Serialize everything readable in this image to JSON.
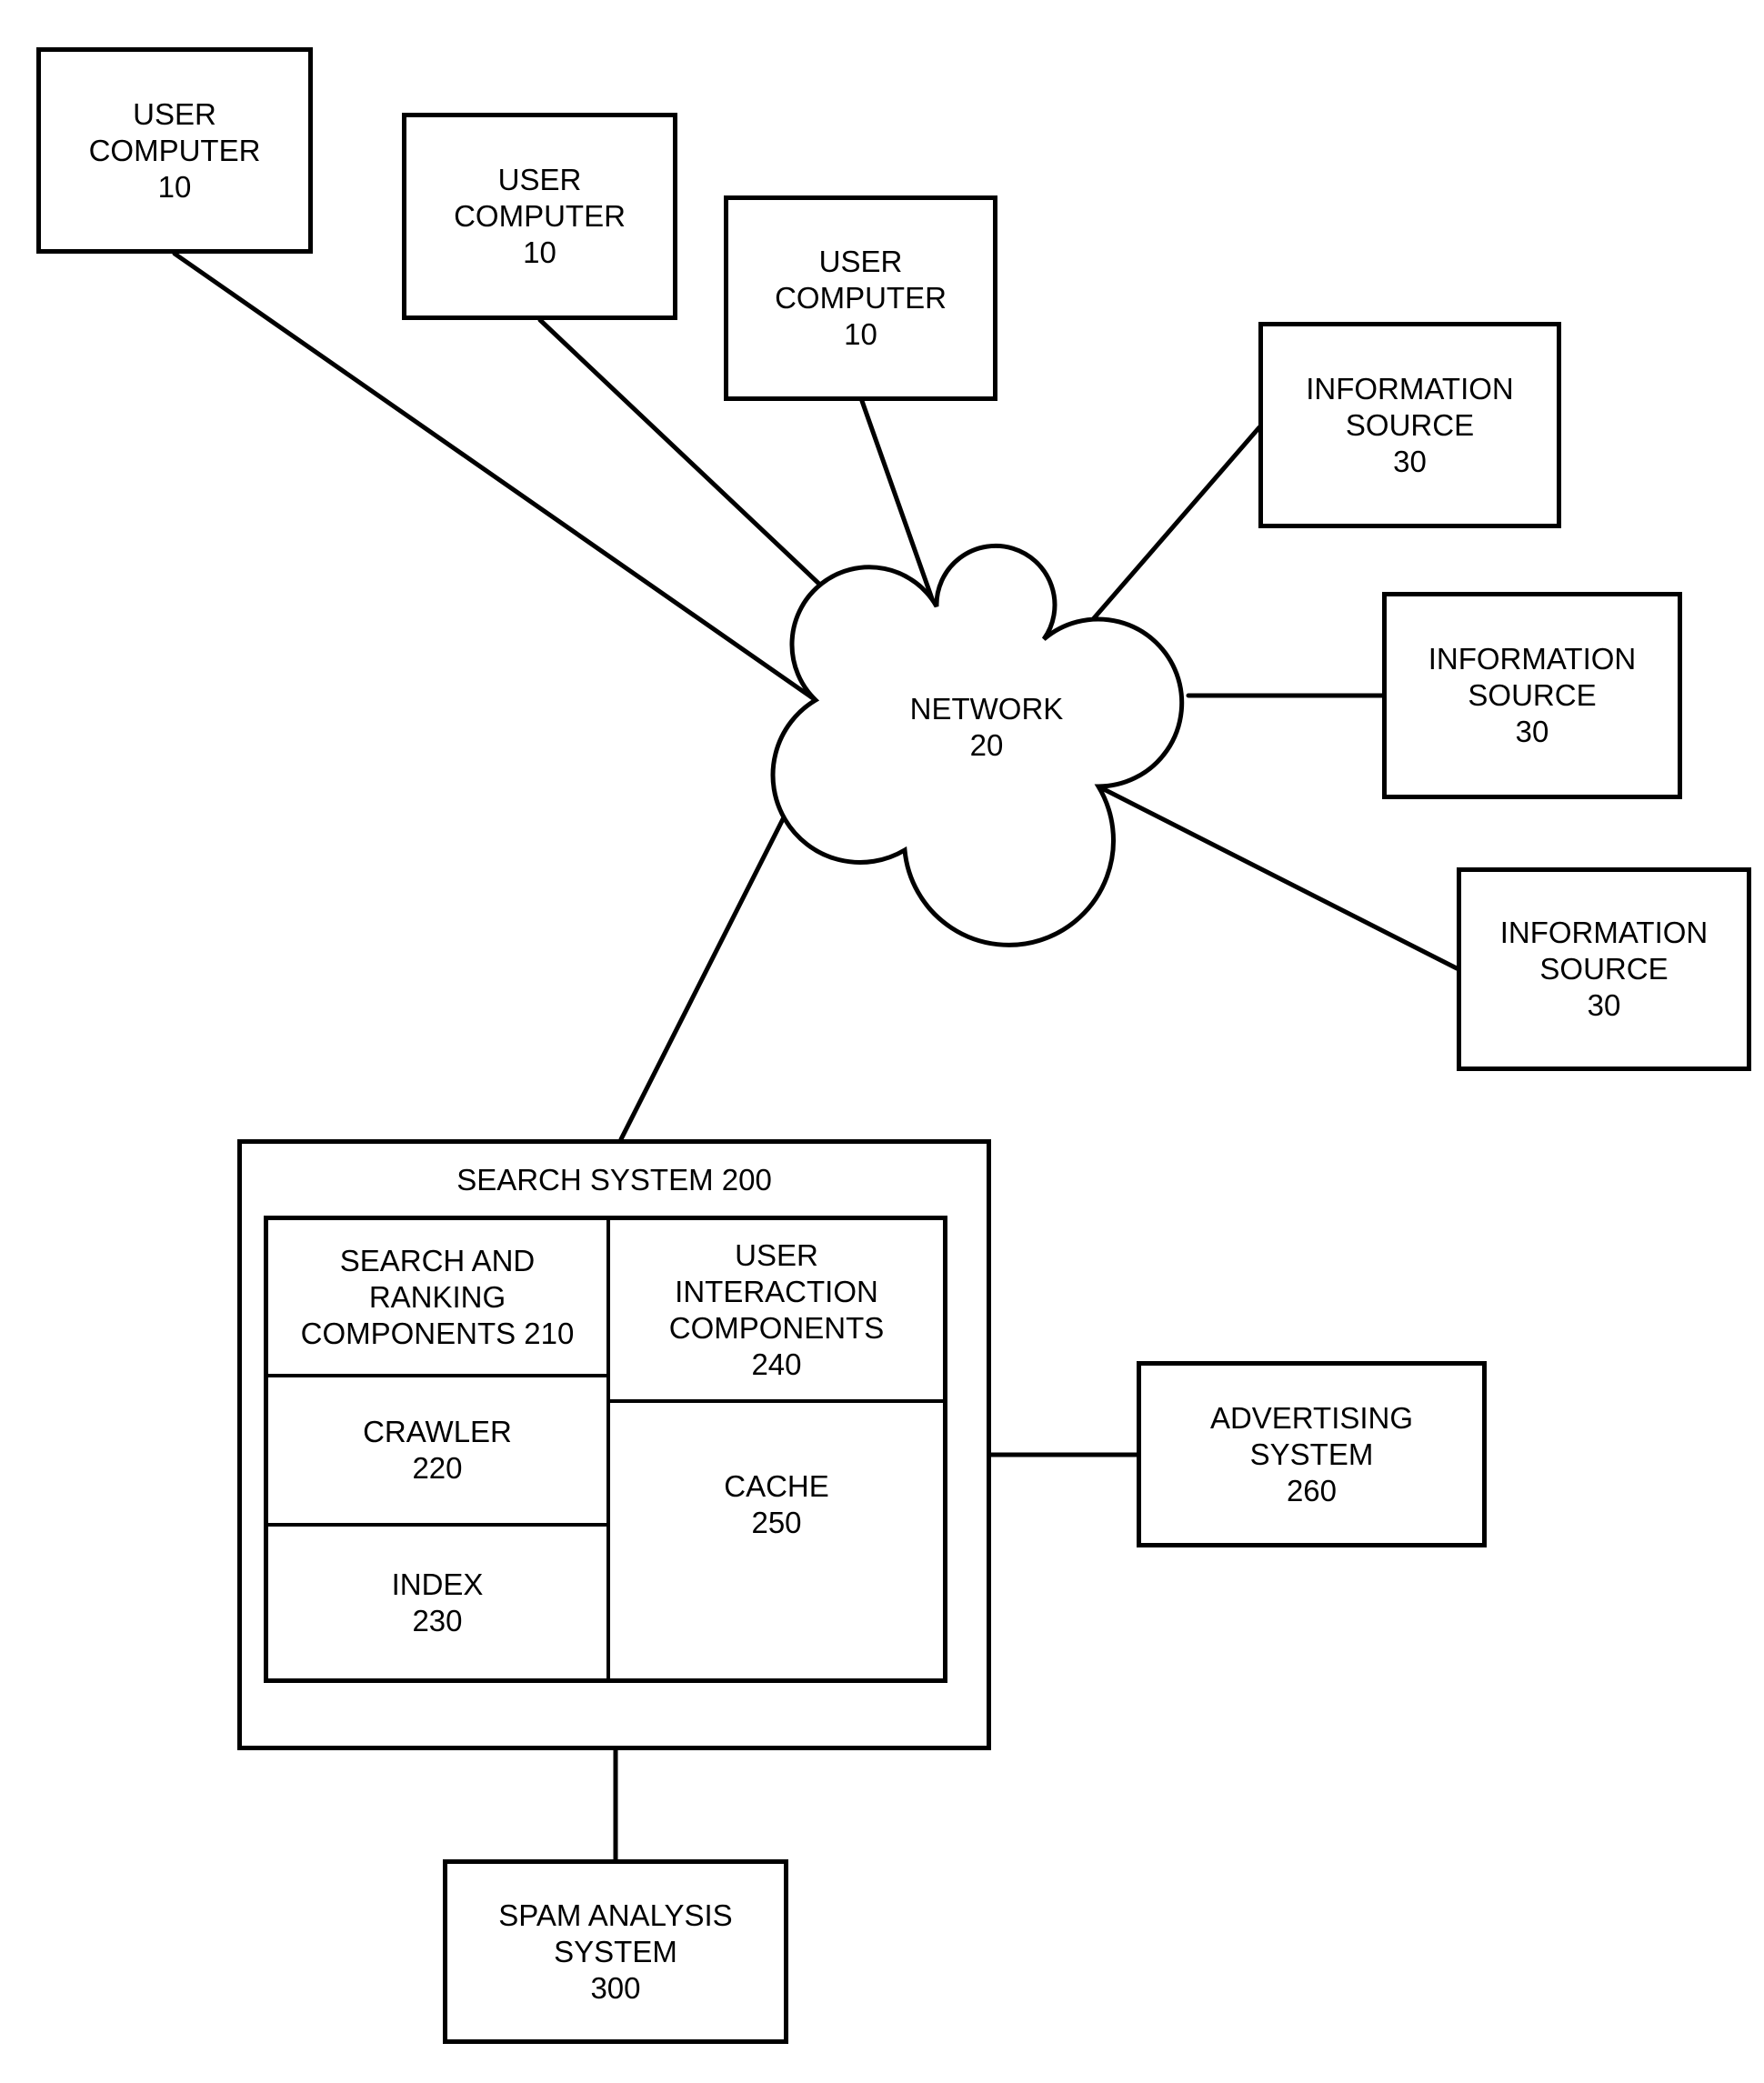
{
  "figure": {
    "user_computers": [
      {
        "title": "USER\nCOMPUTER",
        "ref": "10"
      },
      {
        "title": "USER\nCOMPUTER",
        "ref": "10"
      },
      {
        "title": "USER\nCOMPUTER",
        "ref": "10"
      }
    ],
    "network": {
      "title": "NETWORK",
      "ref": "20"
    },
    "information_sources": [
      {
        "title": "INFORMATION\nSOURCE",
        "ref": "30"
      },
      {
        "title": "INFORMATION\nSOURCE",
        "ref": "30"
      },
      {
        "title": "INFORMATION\nSOURCE",
        "ref": "30"
      }
    ],
    "search_system": {
      "title": "SEARCH SYSTEM 200",
      "components": {
        "search_ranking": "SEARCH AND\nRANKING\nCOMPONENTS 210",
        "crawler": "CRAWLER\n220",
        "index": "INDEX\n230",
        "user_interaction": "USER\nINTERACTION\nCOMPONENTS\n240",
        "cache": "CACHE\n250"
      }
    },
    "advertising_system": {
      "title": "ADVERTISING\nSYSTEM",
      "ref": "260"
    },
    "spam_analysis_system": {
      "title": "SPAM ANALYSIS\nSYSTEM",
      "ref": "300"
    },
    "colors": {
      "stroke": "#000000",
      "background": "#ffffff"
    }
  }
}
